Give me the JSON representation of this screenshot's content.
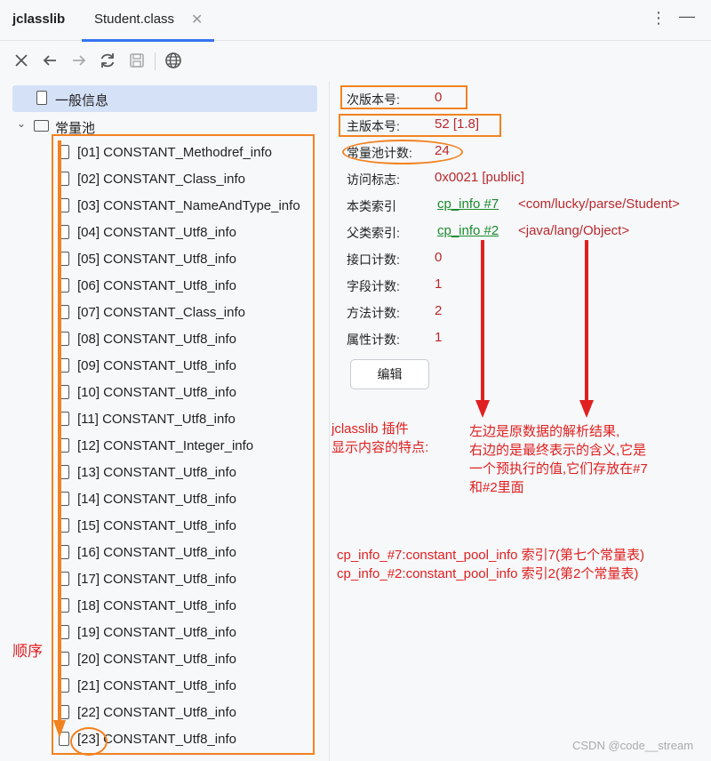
{
  "app": {
    "name": "jclasslib"
  },
  "tab": {
    "label": "Student.class",
    "close": "✕"
  },
  "window": {
    "more": "⋮",
    "minimize": "—"
  },
  "tree": {
    "general": "一般信息",
    "pool": "常量池",
    "items": [
      "[01] CONSTANT_Methodref_info",
      "[02] CONSTANT_Class_info",
      "[03] CONSTANT_NameAndType_info",
      "[04] CONSTANT_Utf8_info",
      "[05] CONSTANT_Utf8_info",
      "[06] CONSTANT_Utf8_info",
      "[07] CONSTANT_Class_info",
      "[08] CONSTANT_Utf8_info",
      "[09] CONSTANT_Utf8_info",
      "[10] CONSTANT_Utf8_info",
      "[11] CONSTANT_Utf8_info",
      "[12] CONSTANT_Integer_info",
      "[13] CONSTANT_Utf8_info",
      "[14] CONSTANT_Utf8_info",
      "[15] CONSTANT_Utf8_info",
      "[16] CONSTANT_Utf8_info",
      "[17] CONSTANT_Utf8_info",
      "[18] CONSTANT_Utf8_info",
      "[19] CONSTANT_Utf8_info",
      "[20] CONSTANT_Utf8_info",
      "[21] CONSTANT_Utf8_info",
      "[22] CONSTANT_Utf8_info",
      "[23] CONSTANT_Utf8_info"
    ]
  },
  "details": {
    "minor_version": {
      "label": "次版本号:",
      "value": "0"
    },
    "major_version": {
      "label": "主版本号:",
      "value": "52 [1.8]"
    },
    "pool_count": {
      "label": "常量池计数:",
      "value": "24"
    },
    "access_flags": {
      "label": "访问标志:",
      "value": "0x0021 [public]"
    },
    "this_class": {
      "label": "本类索引",
      "link": "cp_info #7",
      "resolved": "<com/lucky/parse/Student>"
    },
    "super_class": {
      "label": "父类索引:",
      "link": "cp_info #2",
      "resolved": "<java/lang/Object>"
    },
    "interfaces_count": {
      "label": "接口计数:",
      "value": "0"
    },
    "fields_count": {
      "label": "字段计数:",
      "value": "1"
    },
    "methods_count": {
      "label": "方法计数:",
      "value": "2"
    },
    "attributes_count": {
      "label": "属性计数:",
      "value": "1"
    },
    "edit_button": "编辑"
  },
  "annotations": {
    "order": "顺序",
    "plugin_line1": "jclasslib 插件",
    "plugin_line2": "显示内容的特点:",
    "explain_line1": "左边是原数据的解析结果,",
    "explain_line2": "右边的是最终表示的含义,它是",
    "explain_line3": "一个预执行的值,它们存放在#7",
    "explain_line4": "和#2里面",
    "cp7_note": "cp_info_#7:constant_pool_info 索引7(第七个常量表)",
    "cp2_note": "cp_info_#2:constant_pool_info 索引2(第2个常量表)"
  },
  "watermark": "CSDN @code__stream",
  "colors": {
    "accent": "#3574f0",
    "annotation_orange": "#f28220",
    "annotation_red": "#e02020",
    "value_red": "#b8282c",
    "link_green": "#1a8a2e"
  }
}
